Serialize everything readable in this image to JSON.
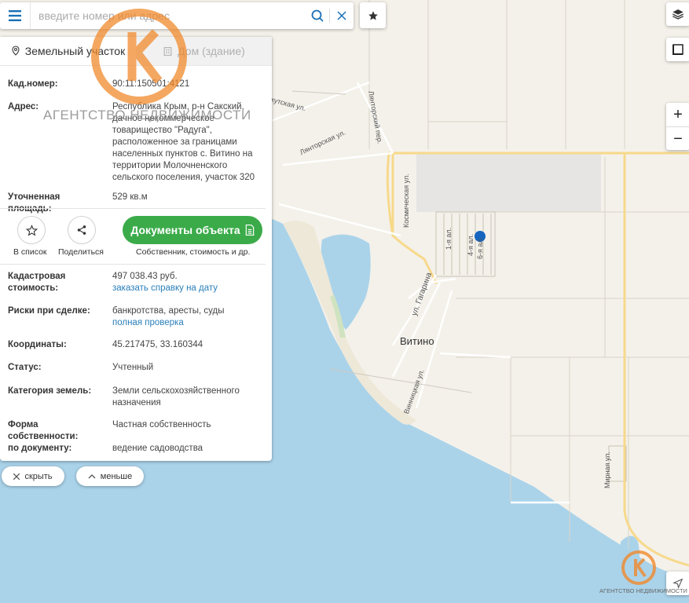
{
  "search": {
    "placeholder": "введите номер или адрес"
  },
  "tabs": [
    {
      "label": "Земельный участок",
      "active": true
    },
    {
      "label": "Дом (здание)",
      "active": false
    }
  ],
  "info": {
    "cad_label": "Кад.номер:",
    "cad_value": "90:11:150501:4121",
    "addr_label": "Адрес:",
    "addr_value": "Республика Крым, р-н Сакский, дачное некоммерческое товарищество \"Радуга\", расположенное за границами населенных пунктов с. Витино на территории Молочненского сельского поселения, участок 320",
    "area_label": "Уточненная площадь:",
    "area_value": "529 кв.м"
  },
  "actions": {
    "list_label": "В список",
    "share_label": "Поделиться",
    "docs_button": "Документы объекта",
    "docs_sub": "Собственник, стоимость и др."
  },
  "details": {
    "cost_label": "Кадастровая стоимость:",
    "cost_value": "497 038.43 руб.",
    "cost_link": "заказать справку на дату",
    "risk_label": "Риски при сделке:",
    "risk_value": "банкротства, аресты, суды",
    "risk_link": "полная проверка",
    "coord_label": "Координаты:",
    "coord_value": "45.217475, 33.160344",
    "status_label": "Статус:",
    "status_value": "Учтенный",
    "category_label": "Категория земель:",
    "category_value": "Земли сельскохозяйственного назначения",
    "ownership_label": "Форма собственности:",
    "ownership_value": "Частная собственность",
    "bydoc_label": "по документу:",
    "bydoc_value": "ведение садоводства"
  },
  "pills": {
    "hide": "скрыть",
    "less": "меньше"
  },
  "watermark": {
    "text": "АГЕНТСТВО НЕДВИЖИМОСТИ",
    "small": "АГЕНТСТВО НЕДВИЖИМОСТИ"
  },
  "map": {
    "labels": {
      "vitino": "Витино",
      "gagarina": "ул. Гагарина",
      "kosmich": "Космическая ул.",
      "vinnits": "Винницкая ул.",
      "lyantor": "Лянторская ул.",
      "lyantor_per": "Лянторский пер.",
      "yakut": "Якутская ул.",
      "mirnaya": "Мирная ул.",
      "al1": "1-я ал.",
      "al4": "4-я ал.",
      "al6": "6-я ал."
    },
    "colors": {
      "sea": "#aad3ea",
      "land": "#f4f1ea",
      "road": "#f7d98b",
      "marker": "#1565c0",
      "green": "#3bab4a",
      "accent": "#1a6fb6"
    }
  },
  "icons": {
    "menu": "menu-icon",
    "search": "search-icon",
    "clear": "close-icon",
    "favorite": "star-icon",
    "land": "pin-icon",
    "house": "building-icon",
    "list": "star-outline-icon",
    "share": "share-icon",
    "doc": "document-icon",
    "layers": "layers-icon",
    "ruler": "ruler-icon",
    "locate": "navigation-icon"
  }
}
